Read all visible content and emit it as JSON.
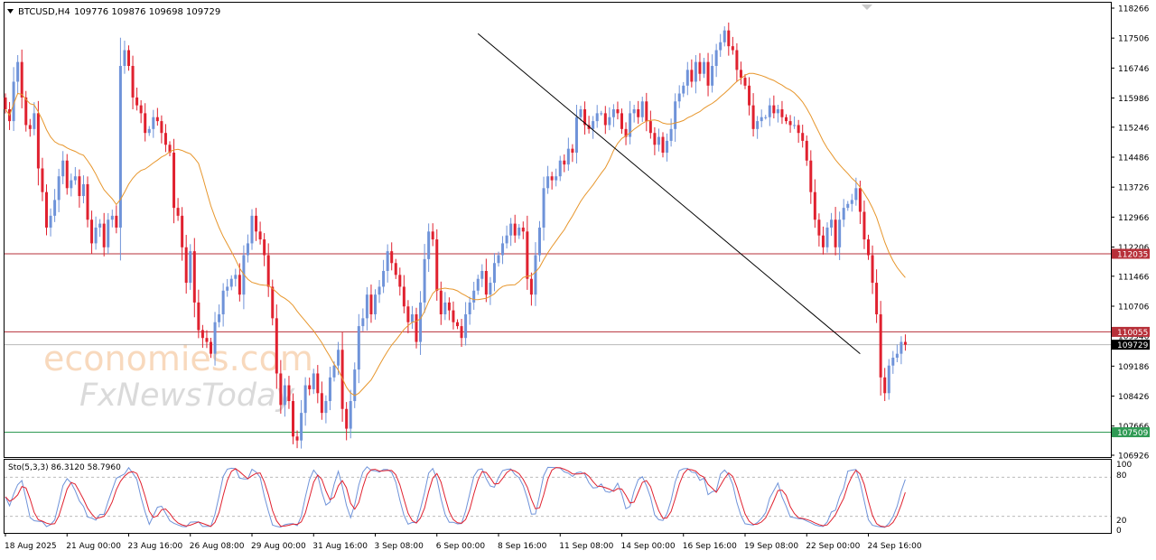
{
  "header": {
    "symbol": "BTCUSD,H4",
    "quote": "109776 109876 109698 109729"
  },
  "indicator": {
    "label": "Sto(5,3,3) 86.3120 58.7960",
    "levels": [
      "100",
      "80",
      "20",
      "0"
    ]
  },
  "watermark": {
    "line1": "economies.com",
    "line2": "FxNewsToday"
  },
  "colors": {
    "bull": "#6f93d9",
    "bear": "#e0212f",
    "ma": "#e7962c",
    "line_red": "#b73039",
    "line_green": "#2f9a54",
    "stoch_main": "#6f93d9",
    "stoch_signal": "#e0212f"
  },
  "chart_data": {
    "type": "candlestick",
    "title": "BTCUSD,H4",
    "y_ticks": [
      "118266",
      "117506",
      "116746",
      "115986",
      "115246",
      "114486",
      "113726",
      "112966",
      "112206",
      "111466",
      "110706",
      "109946",
      "109186",
      "108426",
      "107666",
      "106926"
    ],
    "ylim": [
      106926,
      118266
    ],
    "x_ticks": [
      "18 Aug 2025",
      "21 Aug 00:00",
      "23 Aug 16:00",
      "26 Aug 08:00",
      "29 Aug 00:00",
      "31 Aug 16:00",
      "3 Sep 08:00",
      "6 Sep 00:00",
      "8 Sep 16:00",
      "11 Sep 08:00",
      "14 Sep 00:00",
      "16 Sep 16:00",
      "19 Sep 08:00",
      "22 Sep 00:00",
      "24 Sep 16:00"
    ],
    "last_price": {
      "value": 109729,
      "label": "109729"
    },
    "horizontal_lines": [
      {
        "value": 112035,
        "label": "112035",
        "color": "#b73039"
      },
      {
        "value": 110055,
        "label": "110055",
        "color": "#b73039"
      },
      {
        "value": 107509,
        "label": "107509",
        "color": "#2f9a54"
      }
    ],
    "trendline": {
      "from": [
        115,
        117620
      ],
      "to": [
        208,
        109500
      ]
    },
    "candles_close": [
      115700,
      115400,
      116400,
      116900,
      116000,
      115300,
      115200,
      115600,
      114200,
      113600,
      112700,
      113000,
      113400,
      114000,
      114400,
      113700,
      113900,
      114000,
      113500,
      113800,
      112900,
      112300,
      112700,
      112800,
      112200,
      112900,
      113000,
      112700,
      116800,
      117200,
      116800,
      116000,
      115800,
      115600,
      115100,
      115200,
      115500,
      115400,
      115100,
      114800,
      114600,
      113200,
      113000,
      112200,
      111300,
      112100,
      110800,
      110100,
      109900,
      109800,
      109500,
      110300,
      110500,
      111100,
      111200,
      111400,
      111500,
      111000,
      112000,
      112300,
      113000,
      112600,
      112400,
      112000,
      111200,
      110400,
      109000,
      108200,
      108700,
      108300,
      107400,
      107300,
      108000,
      108700,
      108600,
      109000,
      108500,
      108000,
      108300,
      108900,
      109200,
      109600,
      108100,
      107600,
      108300,
      109100,
      110200,
      110400,
      111000,
      110500,
      111000,
      111200,
      111600,
      112100,
      111800,
      111500,
      111200,
      110700,
      110300,
      110500,
      109800,
      110800,
      111900,
      112600,
      112400,
      111100,
      110500,
      110800,
      110600,
      110300,
      110200,
      109900,
      110500,
      110800,
      111100,
      111400,
      111600,
      111000,
      111300,
      111800,
      112000,
      112300,
      112500,
      112800,
      112500,
      112700,
      112600,
      111400,
      111000,
      112000,
      112700,
      113700,
      114000,
      113900,
      114000,
      114400,
      114300,
      114700,
      114600,
      115500,
      115700,
      115300,
      115200,
      115400,
      115600,
      115600,
      115300,
      115500,
      115700,
      115600,
      115200,
      115000,
      115600,
      115700,
      115500,
      115900,
      115400,
      115100,
      114800,
      115000,
      114600,
      114900,
      115200,
      115900,
      116100,
      116300,
      116700,
      116400,
      116900,
      116600,
      116900,
      116300,
      116800,
      117200,
      117400,
      117700,
      117300,
      117200,
      116700,
      116500,
      116300,
      115800,
      115200,
      115400,
      115500,
      115500,
      115800,
      115600,
      115700,
      115500,
      115400,
      115300,
      115300,
      115100,
      114900,
      114400,
      113600,
      112900,
      112500,
      112200,
      112700,
      112900,
      112200,
      112900,
      113200,
      113300,
      113400,
      113700,
      113100,
      112400,
      112000,
      111300,
      110500,
      108900,
      108500,
      109200,
      109400,
      109500,
      109800,
      109729
    ]
  }
}
